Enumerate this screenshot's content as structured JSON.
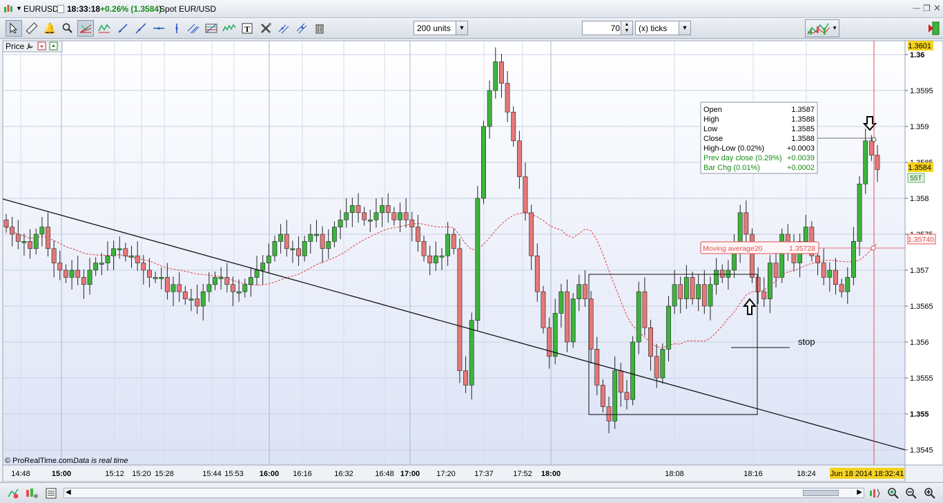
{
  "window": {
    "symbol": "EURUSD",
    "time": "18:33:18",
    "change": "+0.26% (1.3584)",
    "description": "Spot EUR/USD",
    "controls": [
      "minimize-icon",
      "restore-icon",
      "close-icon"
    ]
  },
  "toolbar": {
    "icons": [
      "cursor-icon",
      "ruler-icon",
      "alert-bell-icon",
      "zoom-icon",
      "fan-tool-icon",
      "zigzag-tool-icon",
      "trendline-icon",
      "ray-icon",
      "horizontal-line-icon",
      "vertical-line-icon",
      "parallel-lines-icon",
      "fibonacci-icon",
      "wave-icon",
      "text-tool-icon",
      "settings-tools-icon",
      "channel-icon",
      "delete-icon"
    ],
    "units_value": "200 units",
    "ticks_value": "70",
    "ticks_unit": "(x) ticks"
  },
  "panel": {
    "label": "Price",
    "watermark": "© ProRealTime.com",
    "realtime_note": "Data is real time"
  },
  "info_box": {
    "rows": [
      {
        "label": "Open",
        "value": "1.3587",
        "color": "#000000"
      },
      {
        "label": "High",
        "value": "1.3588",
        "color": "#000000"
      },
      {
        "label": "Low",
        "value": "1.3585",
        "color": "#000000"
      },
      {
        "label": "Close",
        "value": "1.3588",
        "color": "#000000"
      },
      {
        "label": "High-Low (0.02%)",
        "value": "+0.0003",
        "color": "#000000"
      },
      {
        "label": "Prev day close (0.29%)",
        "value": "+0.0039",
        "color": "#1a8a1a"
      },
      {
        "label": "Bar Chg (0.01%)",
        "value": "+0.0002",
        "color": "#1a8a1a"
      }
    ]
  },
  "moving_average": {
    "label": "Moving average20",
    "value": "1.35728",
    "axis_value": "1.35740"
  },
  "annotations": {
    "stop_label": "stop"
  },
  "price_axis": {
    "top_label": "1.3601",
    "current_price": "1.3584",
    "tick_count_badge": "55T",
    "ma_badge": "1.35740"
  },
  "time_axis": {
    "date_badge": "Jun 18 2014 18:32:41"
  },
  "colors": {
    "up_candle": "#3cb43c",
    "down_candle": "#e67878",
    "current_price_badge": "#f5d21e",
    "ma_line": "#e05050"
  },
  "chart_data": {
    "type": "candlestick",
    "series_name": "EURUSD",
    "y_ticks": [
      "1.3545",
      "1.355",
      "1.3555",
      "1.356",
      "1.3565",
      "1.357",
      "1.3575",
      "1.358",
      "1.3585",
      "1.359",
      "1.3595",
      "1.36"
    ],
    "x_ticks": [
      {
        "label": "14:48",
        "bold": false
      },
      {
        "label": "15:00",
        "bold": true
      },
      {
        "label": "15:12",
        "bold": false
      },
      {
        "label": "15:20",
        "bold": false
      },
      {
        "label": "15:28",
        "bold": false
      },
      {
        "label": "15:44",
        "bold": false
      },
      {
        "label": "15:53",
        "bold": false
      },
      {
        "label": "16:00",
        "bold": true
      },
      {
        "label": "16:16",
        "bold": false
      },
      {
        "label": "16:32",
        "bold": false
      },
      {
        "label": "16:48",
        "bold": false
      },
      {
        "label": "17:00",
        "bold": true
      },
      {
        "label": "17:20",
        "bold": false
      },
      {
        "label": "17:37",
        "bold": false
      },
      {
        "label": "17:52",
        "bold": false
      },
      {
        "label": "18:00",
        "bold": true
      },
      {
        "label": "18:08",
        "bold": false
      },
      {
        "label": "18:16",
        "bold": false
      },
      {
        "label": "18:24",
        "bold": false
      }
    ],
    "ylim": [
      1.3543,
      1.3601
    ],
    "closes": [
      1.3576,
      1.3575,
      1.3574,
      1.3574,
      1.3573,
      1.3575,
      1.3576,
      1.3573,
      1.3571,
      1.357,
      1.3569,
      1.357,
      1.3569,
      1.3568,
      1.357,
      1.3571,
      1.3571,
      1.3572,
      1.3573,
      1.3573,
      1.3572,
      1.3572,
      1.3571,
      1.357,
      1.3569,
      1.3569,
      1.3569,
      1.3567,
      1.3568,
      1.3567,
      1.3566,
      1.3566,
      1.3565,
      1.3567,
      1.3568,
      1.3569,
      1.3569,
      1.3568,
      1.3567,
      1.3567,
      1.3568,
      1.3569,
      1.357,
      1.3571,
      1.3572,
      1.3574,
      1.3575,
      1.3573,
      1.3573,
      1.3572,
      1.3574,
      1.3575,
      1.3575,
      1.3573,
      1.3574,
      1.3576,
      1.3577,
      1.3578,
      1.3579,
      1.3578,
      1.3577,
      1.3577,
      1.3578,
      1.3579,
      1.3578,
      1.3577,
      1.3578,
      1.3577,
      1.3576,
      1.3574,
      1.3572,
      1.3571,
      1.3572,
      1.3572,
      1.3575,
      1.3573,
      1.3556,
      1.3554,
      1.3563,
      1.358,
      1.359,
      1.3595,
      1.3599,
      1.3596,
      1.3592,
      1.3588,
      1.3583,
      1.3578,
      1.3572,
      1.3567,
      1.3562,
      1.3558,
      1.3564,
      1.3567,
      1.356,
      1.3566,
      1.3568,
      1.3566,
      1.3559,
      1.3554,
      1.3551,
      1.3549,
      1.3556,
      1.3553,
      1.3552,
      1.356,
      1.3567,
      1.3562,
      1.3558,
      1.3555,
      1.3559,
      1.3565,
      1.3568,
      1.3566,
      1.3569,
      1.3566,
      1.3568,
      1.3565,
      1.3568,
      1.357,
      1.3569,
      1.357,
      1.3573,
      1.3578,
      1.3575,
      1.3569,
      1.3567,
      1.3566,
      1.3571,
      1.3569,
      1.3575,
      1.3573,
      1.3571,
      1.3574,
      1.3576,
      1.3572,
      1.3571,
      1.3569,
      1.357,
      1.3568,
      1.3567,
      1.3569,
      1.3574,
      1.3582,
      1.3588,
      1.3586,
      1.3584
    ]
  }
}
